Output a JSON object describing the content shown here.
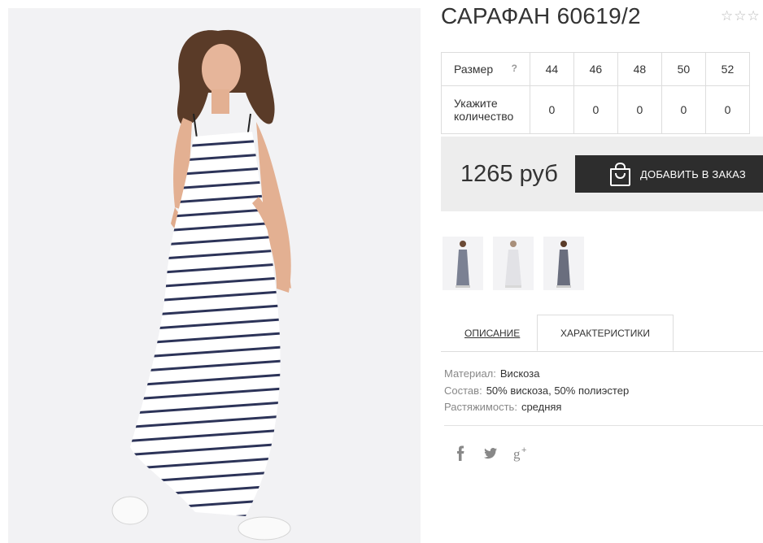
{
  "product": {
    "title": "САРАФАН 60619/2",
    "rating_stars": [
      "☆",
      "☆",
      "☆"
    ]
  },
  "size_table": {
    "size_label": "Размер",
    "help_icon": "?",
    "sizes": [
      "44",
      "46",
      "48",
      "50",
      "52"
    ],
    "quantity_label": "Укажите количество",
    "quantities": [
      "0",
      "0",
      "0",
      "0",
      "0"
    ]
  },
  "purchase": {
    "price": "1265 руб",
    "add_button_label": "ДОБАВИТЬ В ЗАКАЗ",
    "button_icon": "shopping-bag-icon"
  },
  "tabs": {
    "description_label": "ОПИСАНИЕ",
    "characteristics_label": "ХАРАКТЕРИСТИКИ",
    "active": "characteristics"
  },
  "specs": [
    {
      "key": "Материал:",
      "value": "Вискоза"
    },
    {
      "key": "Состав:",
      "value": "50% вискоза, 50% полиэстер"
    },
    {
      "key": "Растяжимость:",
      "value": "средняя"
    }
  ],
  "social": [
    "facebook-icon",
    "twitter-icon",
    "google-plus-icon"
  ],
  "colors": {
    "button_bg": "#2d2d2d",
    "price_box_bg": "#ededed",
    "stripe_navy": "#2c3358"
  }
}
